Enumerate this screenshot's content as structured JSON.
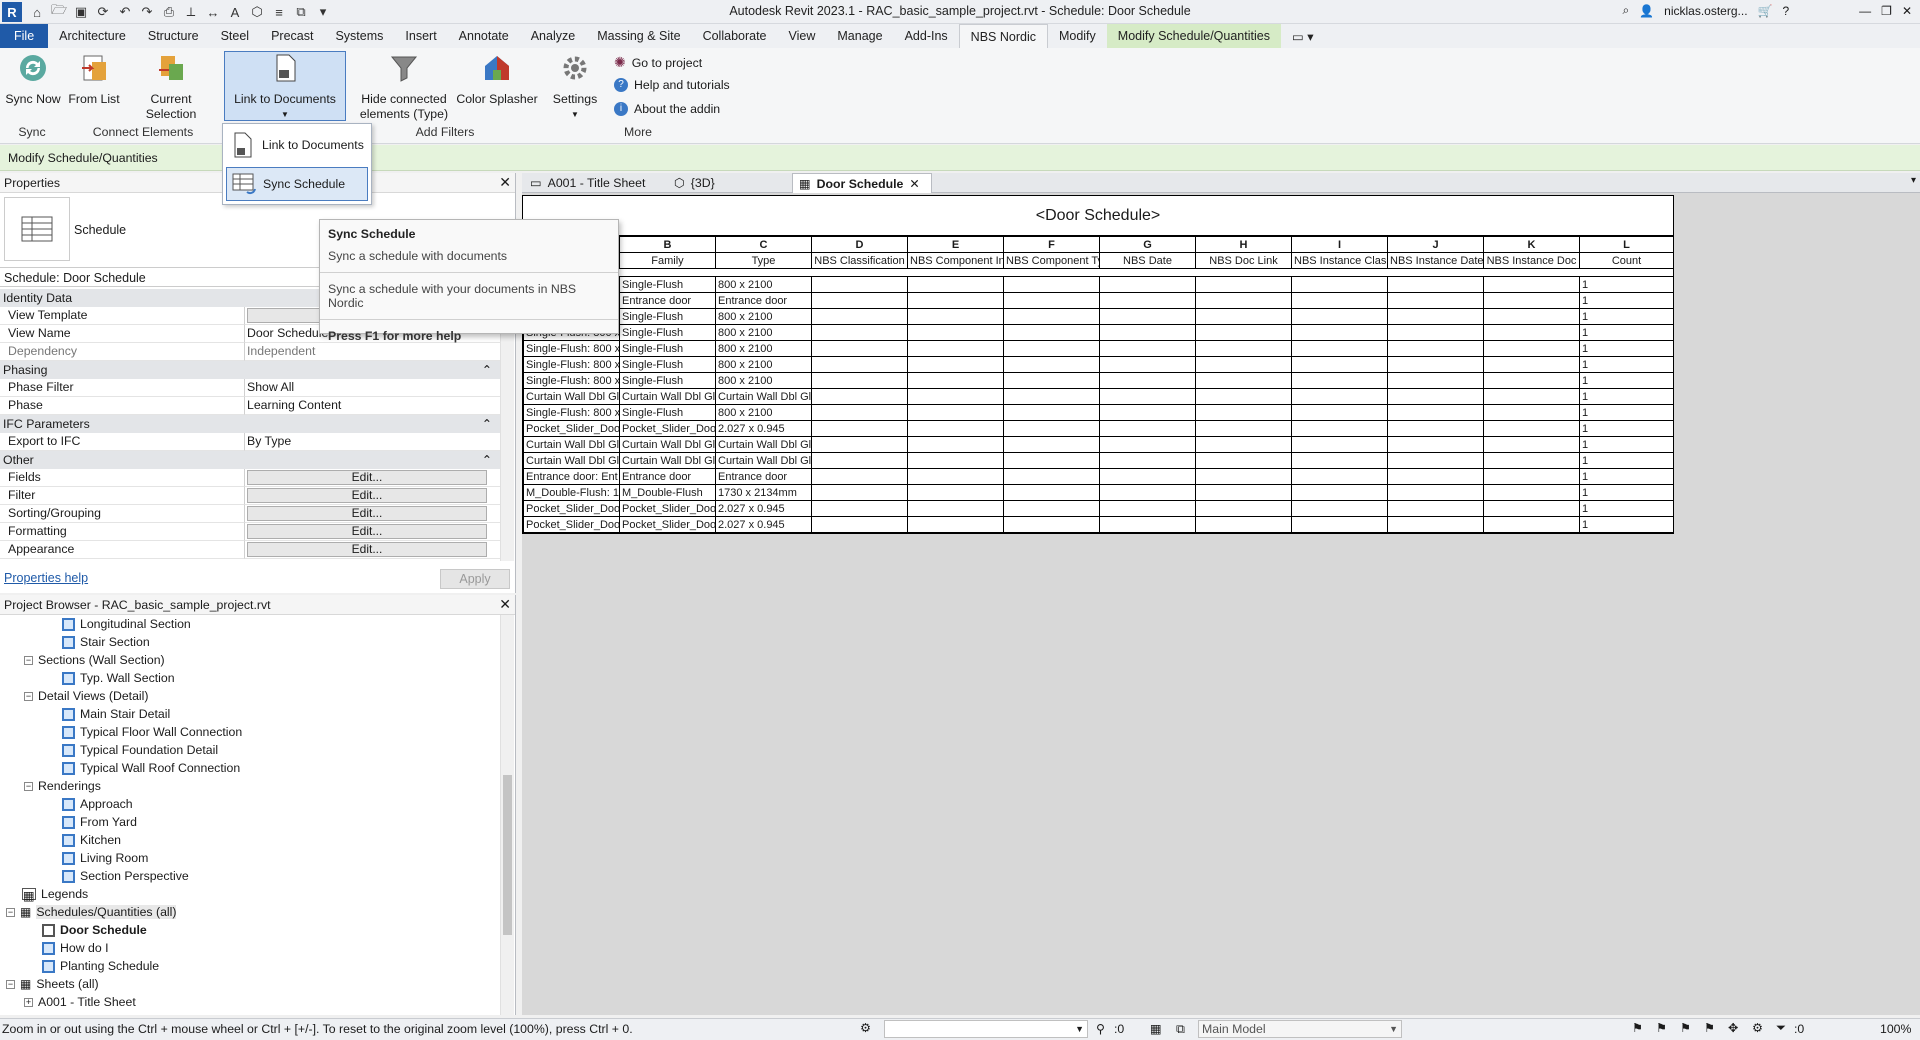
{
  "window": {
    "title": "Autodesk Revit 2023.1 - RAC_basic_sample_project.rvt - Schedule: Door Schedule",
    "user": "nicklas.osterg..."
  },
  "tabs": [
    "File",
    "Architecture",
    "Structure",
    "Steel",
    "Precast",
    "Systems",
    "Insert",
    "Annotate",
    "Analyze",
    "Massing & Site",
    "Collaborate",
    "View",
    "Manage",
    "Add-Ins",
    "NBS Nordic",
    "Modify",
    "Modify Schedule/Quantities"
  ],
  "ribbon": {
    "sync_now": "Sync Now",
    "from_list": "From List",
    "current_selection": "Current Selection",
    "link_to_documents": "Link to Documents",
    "hide_connected_1": "Hide connected",
    "hide_connected_2": "elements (Type)",
    "color_splasher": "Color Splasher",
    "settings": "Settings",
    "go_to_project": "Go to project",
    "help_tutorials": "Help and tutorials",
    "about_addin": "About the addin",
    "groups": {
      "sync": "Sync",
      "connect": "Connect Elements",
      "filters": "Add Filters",
      "more": "More"
    }
  },
  "context_bar": "Modify Schedule/Quantities",
  "dropdown": {
    "item1": "Link to Documents",
    "item2": "Sync Schedule"
  },
  "tooltip": {
    "title": "Sync Schedule",
    "subtitle": "Sync a schedule with documents",
    "body": "Sync a schedule with your documents in NBS Nordic",
    "help": "Press F1 for more help"
  },
  "properties": {
    "header": "Properties",
    "type": "Schedule",
    "selector": "Schedule: Door Schedule",
    "identity": "Identity Data",
    "view_template": "View Template",
    "view_name": "View Name",
    "view_name_val": "Door Schedule",
    "dependency": "Dependency",
    "dependency_val": "Independent",
    "phasing": "Phasing",
    "phase_filter": "Phase Filter",
    "phase_filter_val": "Show All",
    "phase": "Phase",
    "phase_val": "Learning Content",
    "ifc": "IFC Parameters",
    "export_ifc": "Export to IFC",
    "export_ifc_val": "By Type",
    "other": "Other",
    "fields": "Fields",
    "filter": "Filter",
    "sorting": "Sorting/Grouping",
    "formatting": "Formatting",
    "appearance": "Appearance",
    "edit": "Edit...",
    "help_link": "Properties help",
    "apply": "Apply"
  },
  "browser": {
    "header": "Project Browser - RAC_basic_sample_project.rvt",
    "items": [
      "Longitudinal Section",
      "Stair Section",
      "Sections (Wall Section)",
      "Typ. Wall Section",
      "Detail Views (Detail)",
      "Main Stair Detail",
      "Typical Floor Wall Connection",
      "Typical Foundation Detail",
      "Typical Wall Roof Connection",
      "Renderings",
      "Approach",
      "From Yard",
      "Kitchen",
      "Living Room",
      "Section Perspective",
      "Legends",
      "Schedules/Quantities (all)",
      "Door Schedule",
      "How do I",
      "Planting Schedule",
      "Sheets (all)",
      "A001 - Title Sheet"
    ]
  },
  "view_tabs": [
    "A001 - Title Sheet",
    "{3D}",
    "Door Schedule"
  ],
  "schedule": {
    "title": "<Door Schedule>",
    "letters": [
      "A",
      "B",
      "C",
      "D",
      "E",
      "F",
      "G",
      "H",
      "I",
      "J",
      "K",
      "L"
    ],
    "headers": [
      "",
      "Family",
      "Type",
      "NBS Classification",
      "NBS Component In",
      "NBS Component Ty",
      "NBS Date",
      "NBS Doc Link",
      "NBS Instance Clas",
      "NBS Instance Date",
      "NBS Instance Doc",
      "Count"
    ],
    "rows": [
      [
        "",
        "Single-Flush",
        "800 x 2100",
        "1"
      ],
      [
        "",
        "Entrance door",
        "Entrance door",
        "1"
      ],
      [
        "",
        "Single-Flush",
        "800 x 2100",
        "1"
      ],
      [
        "Single-Flush: 800 x",
        "Single-Flush",
        "800 x 2100",
        "1"
      ],
      [
        "Single-Flush: 800 x",
        "Single-Flush",
        "800 x 2100",
        "1"
      ],
      [
        "Single-Flush: 800 x",
        "Single-Flush",
        "800 x 2100",
        "1"
      ],
      [
        "Single-Flush: 800 x",
        "Single-Flush",
        "800 x 2100",
        "1"
      ],
      [
        "Curtain Wall Dbl Gl",
        "Curtain Wall Dbl Gl",
        "Curtain Wall Dbl Gl",
        "1"
      ],
      [
        "Single-Flush: 800 x",
        "Single-Flush",
        "800 x 2100",
        "1"
      ],
      [
        "Pocket_Slider_Doo",
        "Pocket_Slider_Doo",
        "2.027 x 0.945",
        "1"
      ],
      [
        "Curtain Wall Dbl Gl",
        "Curtain Wall Dbl Gl",
        "Curtain Wall Dbl Gl",
        "1"
      ],
      [
        "Curtain Wall Dbl Gl",
        "Curtain Wall Dbl Gl",
        "Curtain Wall Dbl Gl",
        "1"
      ],
      [
        "Entrance door: Ent",
        "Entrance door",
        "Entrance door",
        "1"
      ],
      [
        "M_Double-Flush: 1",
        "M_Double-Flush",
        "1730 x 2134mm",
        "1"
      ],
      [
        "Pocket_Slider_Doo",
        "Pocket_Slider_Doo",
        "2.027 x 0.945",
        "1"
      ],
      [
        "Pocket_Slider_Doo",
        "Pocket_Slider_Doo",
        "2.027 x 0.945",
        "1"
      ]
    ]
  },
  "status": {
    "hint": "Zoom in or out using the Ctrl + mouse wheel or Ctrl + [+/-]. To reset to the original zoom level (100%), press Ctrl + 0.",
    "counter": ":0",
    "model": "Main Model",
    "filter_count": ":0",
    "zoom": "100%"
  },
  "colors": {
    "file_tab": "#1f5aa8",
    "context_tab": "#d6ebc6",
    "context_bar": "#e5f3dc"
  }
}
